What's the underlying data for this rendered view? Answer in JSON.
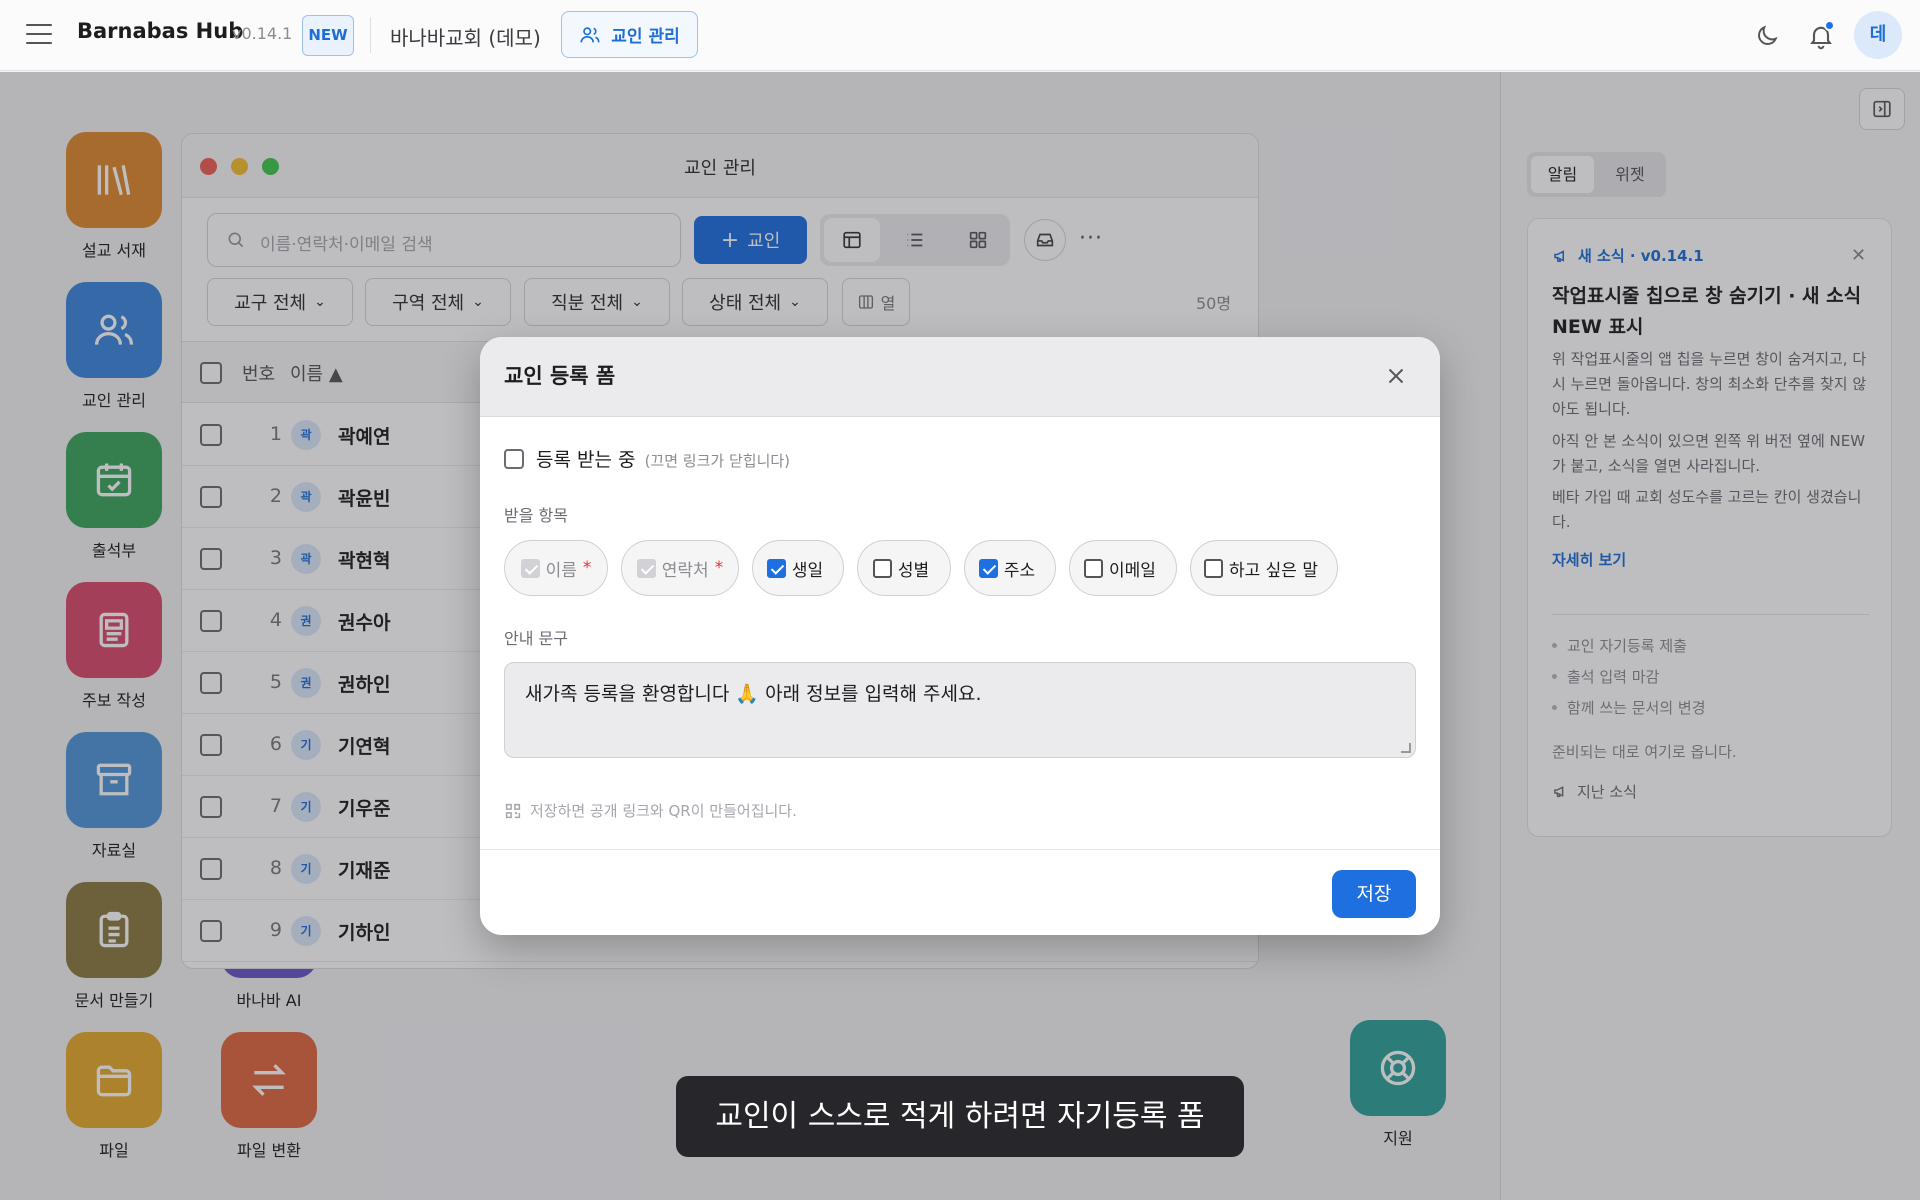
{
  "topbar": {
    "app_name": "Barnabas Hub",
    "version": "v0.14.1",
    "new_badge": "NEW",
    "church_name": "바나바교회 (데모)",
    "active_tab": "교인 관리",
    "avatar_initial": "데"
  },
  "desktop_apps": [
    {
      "label": "설교 서재",
      "color": "#e0892f",
      "icon": "library-icon"
    },
    {
      "label": "교인 관리",
      "color": "#3c86dc",
      "icon": "users-icon"
    },
    {
      "label": "출석부",
      "color": "#3ba55c",
      "icon": "calendar-check-icon"
    },
    {
      "label": "주보 작성",
      "color": "#d94a6b",
      "icon": "newspaper-icon"
    },
    {
      "label": "자료실",
      "color": "#4f96d8",
      "icon": "archive-icon"
    },
    {
      "label": "문서 만들기",
      "color": "#8a7a40",
      "icon": "clipboard-icon"
    },
    {
      "label": "바나바 AI",
      "color": "#6b54c7",
      "icon": "ai-icon"
    },
    {
      "label": "파일",
      "color": "#e7a92b",
      "icon": "folder-icon"
    },
    {
      "label": "파일 변환",
      "color": "#e0673f",
      "icon": "swap-icon"
    },
    {
      "label": "지원",
      "color": "#2fa39a",
      "icon": "lifebuoy-icon"
    }
  ],
  "member_window": {
    "title": "교인 관리",
    "search_placeholder": "이름·연락처·이메일 검색",
    "add_button": "교인",
    "filters": [
      "교구 전체",
      "구역 전체",
      "직분 전체",
      "상태 전체"
    ],
    "columns_button": "열",
    "count": "50명",
    "header_no": "번호",
    "header_name": "이름 ▲",
    "rows": [
      {
        "no": "1",
        "initial": "곽",
        "name": "곽예연"
      },
      {
        "no": "2",
        "initial": "곽",
        "name": "곽윤빈"
      },
      {
        "no": "3",
        "initial": "곽",
        "name": "곽현혁"
      },
      {
        "no": "4",
        "initial": "권",
        "name": "권수아"
      },
      {
        "no": "5",
        "initial": "권",
        "name": "권하인"
      },
      {
        "no": "6",
        "initial": "기",
        "name": "기연혁"
      },
      {
        "no": "7",
        "initial": "기",
        "name": "기우준"
      },
      {
        "no": "8",
        "initial": "기",
        "name": "기재준"
      },
      {
        "no": "9",
        "initial": "기",
        "name": "기하인"
      }
    ]
  },
  "right_panel": {
    "tabs": [
      "알림",
      "위젯"
    ],
    "news_header": "새 소식 · v0.14.1",
    "news_title": "작업표시줄 칩으로 창 숨기기 · 새 소식 NEW 표시",
    "paragraphs": [
      "위 작업표시줄의 앱 칩을 누르면 창이 숨겨지고, 다시 누르면 돌아옵니다. 창의 최소화 단추를 찾지 않아도 됩니다.",
      "아직 안 본 소식이 있으면 왼쪽 위 버전 옆에 NEW 가 붙고, 소식을 열면 사라집니다.",
      "베타 가입 때 교회 성도수를 고르는 칸이 생겼습니다."
    ],
    "more_link": "자세히 보기",
    "upcoming": [
      "교인 자기등록 제출",
      "출석 입력 마감",
      "함께 쓰는 문서의 변경"
    ],
    "upcoming_note": "준비되는 대로 여기로 옵니다.",
    "past_news": "지난 소식"
  },
  "modal": {
    "title": "교인 등록 폼",
    "receiving_label": "등록 받는 중",
    "receiving_hint": "(끄면 링크가 닫힙니다)",
    "receiving_on": false,
    "fields_label": "받을 항목",
    "fields": [
      {
        "label": "이름",
        "required": "*",
        "checked": true,
        "locked": true
      },
      {
        "label": "연락처",
        "required": "*",
        "checked": true,
        "locked": true
      },
      {
        "label": "생일",
        "required": "",
        "checked": true,
        "locked": false
      },
      {
        "label": "성별",
        "required": "",
        "checked": false,
        "locked": false
      },
      {
        "label": "주소",
        "required": "",
        "checked": true,
        "locked": false
      },
      {
        "label": "이메일",
        "required": "",
        "checked": false,
        "locked": false
      },
      {
        "label": "하고 싶은 말",
        "required": "",
        "checked": false,
        "locked": false
      }
    ],
    "guide_label": "안내 문구",
    "guide_text": "새가족 등록을 환영합니다 🙏 아래 정보를 입력해 주세요.",
    "qr_hint": "저장하면 공개 링크와 QR이 만들어집니다.",
    "save_button": "저장"
  },
  "toast": "교인이 스스로 적게 하려면 자기등록 폼",
  "colors": {
    "accent": "#1e6fe0",
    "required": "#d93a3a"
  }
}
